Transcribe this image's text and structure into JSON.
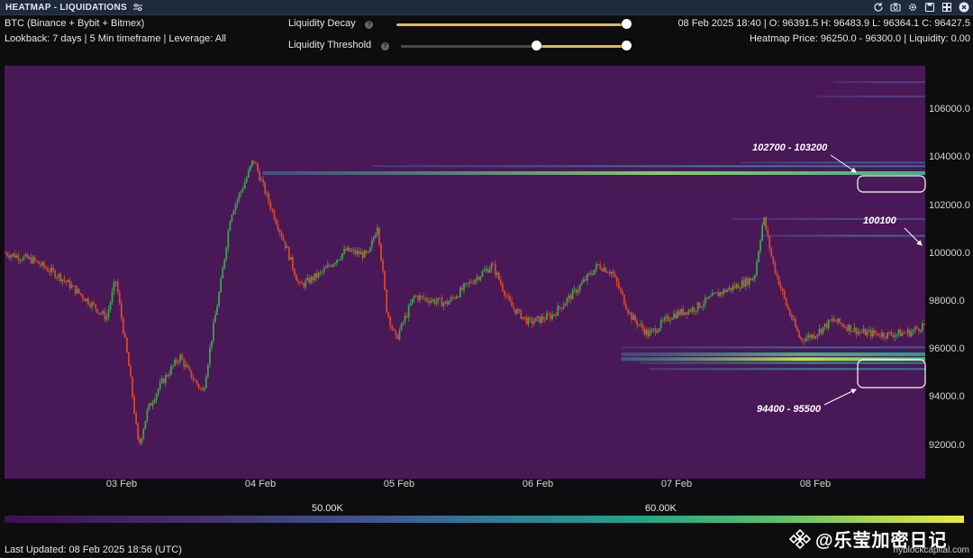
{
  "window": {
    "title": "HEATMAP - LIQUIDATIONS"
  },
  "info": {
    "exchange": "BTC (Binance + Bybit + Bitmex)",
    "lookback": "Lookback: 7 days | 5 Min timeframe | Leverage: All",
    "ohlc": "08 Feb 2025 18:40 | O: 96391.5 H: 96483.9 L: 96364.1 C: 96427.5",
    "heatmap_price": "Heatmap Price: 96250.0 - 96300.0 | Liquidity: 0.00"
  },
  "controls": {
    "decay_label": "Liquidity Decay",
    "threshold_label": "Liquidity Threshold",
    "help_glyph": "?",
    "decay_value": 1.0,
    "threshold_range": [
      0.6,
      1.0
    ],
    "accent": "#e6b84a"
  },
  "axis": {
    "y_ticks": [
      "106000.0",
      "104000.0",
      "102000.0",
      "100000.0",
      "98000.0",
      "96000.0",
      "94000.0",
      "92000.0"
    ],
    "x_ticks": [
      "03 Feb",
      "04 Feb",
      "05 Feb",
      "06 Feb",
      "07 Feb",
      "08 Feb"
    ]
  },
  "annotations": {
    "upper_zone": "102700 - 103200",
    "mid_level": "100100",
    "lower_zone": "94400 - 95500"
  },
  "colorbar": {
    "label_low": "50.00K",
    "label_high": "60.00K"
  },
  "footer": {
    "last_updated": "Last Updated: 08 Feb 2025 18:56 (UTC)",
    "watermark": "@乐莹加密日记",
    "site": "hyblockcapital.com"
  },
  "colors": {
    "background": "#491857",
    "up": "#3fa34d",
    "down": "#d9482a",
    "heat_high": "#eaea3c"
  },
  "chart_data": {
    "type": "heatmap",
    "title": "",
    "ylim": [
      90000,
      107200
    ],
    "price_series": [
      [
        0.0,
        99400
      ],
      [
        0.03,
        99100
      ],
      [
        0.06,
        98400
      ],
      [
        0.09,
        97400
      ],
      [
        0.11,
        96700
      ],
      [
        0.12,
        98300
      ],
      [
        0.135,
        94500
      ],
      [
        0.145,
        91300
      ],
      [
        0.155,
        92900
      ],
      [
        0.17,
        94000
      ],
      [
        0.19,
        95100
      ],
      [
        0.2,
        94400
      ],
      [
        0.215,
        93600
      ],
      [
        0.225,
        96000
      ],
      [
        0.235,
        98300
      ],
      [
        0.245,
        101000
      ],
      [
        0.26,
        102300
      ],
      [
        0.27,
        103300
      ],
      [
        0.285,
        101700
      ],
      [
        0.305,
        99700
      ],
      [
        0.32,
        98000
      ],
      [
        0.345,
        98600
      ],
      [
        0.37,
        99500
      ],
      [
        0.395,
        99300
      ],
      [
        0.405,
        100600
      ],
      [
        0.415,
        97000
      ],
      [
        0.425,
        95800
      ],
      [
        0.445,
        97600
      ],
      [
        0.48,
        97300
      ],
      [
        0.51,
        98300
      ],
      [
        0.53,
        98900
      ],
      [
        0.55,
        97200
      ],
      [
        0.57,
        96500
      ],
      [
        0.595,
        96800
      ],
      [
        0.62,
        97800
      ],
      [
        0.645,
        98900
      ],
      [
        0.66,
        98600
      ],
      [
        0.68,
        96800
      ],
      [
        0.7,
        96000
      ],
      [
        0.725,
        96800
      ],
      [
        0.75,
        97100
      ],
      [
        0.775,
        97700
      ],
      [
        0.8,
        98100
      ],
      [
        0.815,
        98400
      ],
      [
        0.825,
        100900
      ],
      [
        0.835,
        99000
      ],
      [
        0.85,
        97200
      ],
      [
        0.865,
        95800
      ],
      [
        0.88,
        96000
      ],
      [
        0.9,
        96600
      ],
      [
        0.93,
        96100
      ],
      [
        0.96,
        96000
      ],
      [
        0.985,
        96100
      ],
      [
        1.0,
        96430
      ]
    ],
    "liquidity_bands": [
      {
        "price": 102750,
        "intensity": 0.85,
        "start": 0.28
      },
      {
        "price": 103000,
        "intensity": 0.45,
        "start": 0.4
      },
      {
        "price": 103150,
        "intensity": 0.3,
        "start": 0.8
      },
      {
        "price": 100100,
        "intensity": 0.35,
        "start": 0.82
      },
      {
        "price": 100800,
        "intensity": 0.2,
        "start": 0.79
      },
      {
        "price": 95450,
        "intensity": 0.35,
        "start": 0.67
      },
      {
        "price": 95200,
        "intensity": 0.7,
        "start": 0.67
      },
      {
        "price": 95000,
        "intensity": 0.95,
        "start": 0.67
      },
      {
        "price": 94800,
        "intensity": 0.55,
        "start": 0.69
      },
      {
        "price": 94550,
        "intensity": 0.5,
        "start": 0.7
      },
      {
        "price": 105900,
        "intensity": 0.15,
        "start": 0.88
      },
      {
        "price": 106500,
        "intensity": 0.15,
        "start": 0.9
      }
    ]
  }
}
